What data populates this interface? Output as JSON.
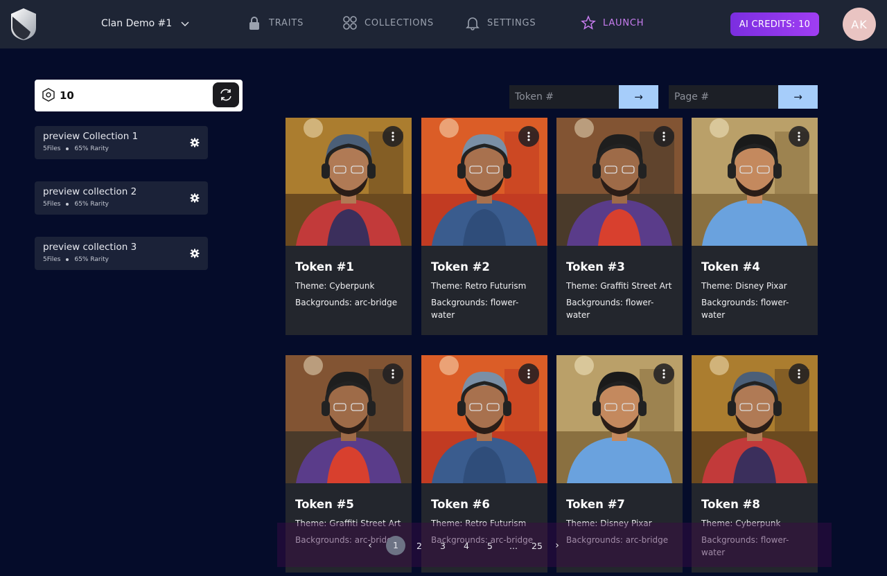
{
  "header": {
    "project_name": "Clan Demo #1",
    "nav": [
      {
        "label": "TRAITS",
        "icon": "lock-icon"
      },
      {
        "label": "COLLECTIONS",
        "icon": "grid-circles-icon"
      },
      {
        "label": "SETTINGS",
        "icon": "bell-icon"
      },
      {
        "label": "LAUNCH",
        "icon": "star-icon"
      }
    ],
    "credits_label": "AI CREDITS: 10",
    "avatar_initials": "AK",
    "launch_color": "#c87df0",
    "credits_color": "#8a33e8"
  },
  "sidebar": {
    "count": "10",
    "collections": [
      {
        "title": "preview Collection 1",
        "files": "5Files",
        "rarity": "65% Rarity"
      },
      {
        "title": "preview collection 2",
        "files": "5Files",
        "rarity": "65% Rarity"
      },
      {
        "title": "preview collection 3",
        "files": "5Files",
        "rarity": "65% Rarity"
      }
    ]
  },
  "search": {
    "token_placeholder": "Token #",
    "page_placeholder": "Page #",
    "go_label": "→"
  },
  "tokens": [
    {
      "name": "Token #1",
      "theme": "Theme: Cyberpunk",
      "backgrounds": "Backgrounds: arc-bridge",
      "art": "cyberpunk"
    },
    {
      "name": "Token #2",
      "theme": "Theme: Retro Futurism",
      "backgrounds": "Backgrounds: flower-water",
      "art": "retro"
    },
    {
      "name": "Token #3",
      "theme": "Theme: Graffiti Street Art",
      "backgrounds": "Backgrounds: flower-water",
      "art": "graffiti"
    },
    {
      "name": "Token #4",
      "theme": "Theme: Disney Pixar",
      "backgrounds": "Backgrounds: flower-water",
      "art": "pixar"
    },
    {
      "name": "Token #5",
      "theme": "Theme: Graffiti Street Art",
      "backgrounds": "Backgrounds: arc-bridge",
      "art": "graffiti"
    },
    {
      "name": "Token #6",
      "theme": "Theme: Retro Futurism",
      "backgrounds": "Backgrounds: arc-bridge",
      "art": "retro"
    },
    {
      "name": "Token #7",
      "theme": "Theme: Disney Pixar",
      "backgrounds": "Backgrounds: arc-bridge",
      "art": "pixar"
    },
    {
      "name": "Token #8",
      "theme": "Theme: Cyberpunk",
      "backgrounds": "Backgrounds: flower-water",
      "art": "cyberpunk"
    }
  ],
  "pagination": {
    "prev": "‹",
    "pages": [
      "1",
      "2",
      "3",
      "4",
      "5",
      "...",
      "25"
    ],
    "current": "1",
    "next": "›"
  }
}
